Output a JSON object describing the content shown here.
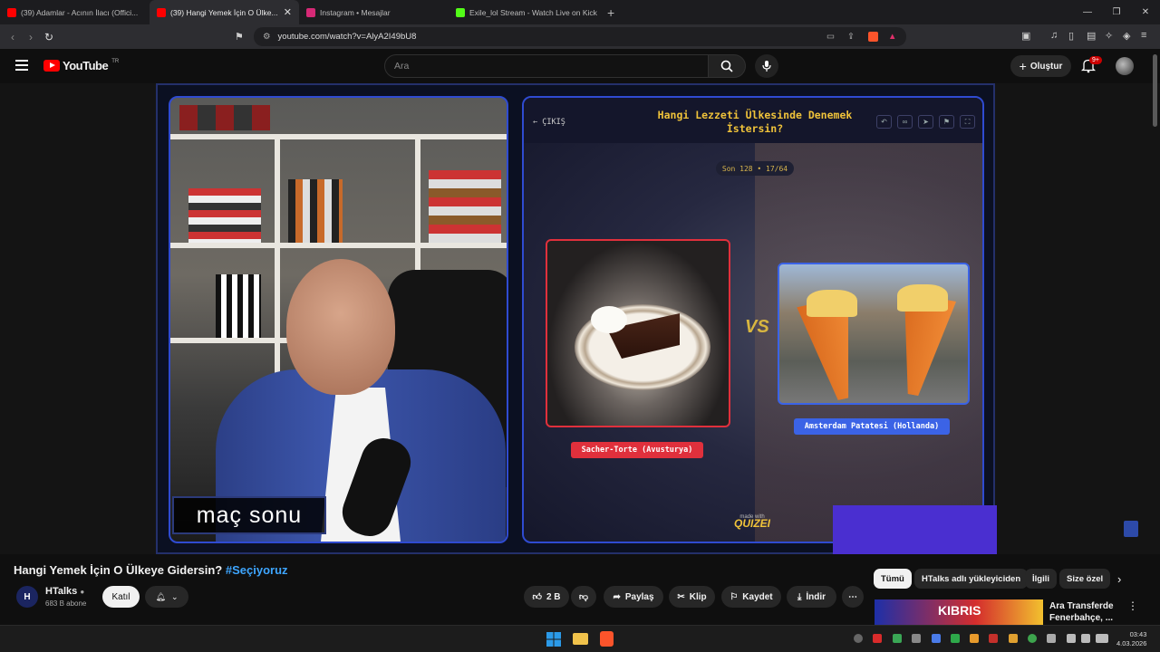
{
  "browser": {
    "tabs": [
      {
        "label": "(39) Adamlar - Acının İlacı (Offici...",
        "color": "#ff0000",
        "active": false
      },
      {
        "label": "(39) Hangi Yemek İçin O Ülke...",
        "color": "#ff0000",
        "active": true
      },
      {
        "label": "Instagram • Mesajlar",
        "color": "#d62976",
        "active": false
      },
      {
        "label": "Exile_lol Stream - Watch Live on Kick",
        "color": "#53fc18",
        "active": false
      }
    ],
    "url": "youtube.com/watch?v=AlyA2I49bU8"
  },
  "youtube": {
    "logo_text": "YouTube",
    "region": "TR",
    "search_placeholder": "Ara",
    "create_label": "Oluştur",
    "notif_count": "9+"
  },
  "video": {
    "cam_caption": "maç sonu",
    "quiz": {
      "back_label": "← ÇIKIŞ",
      "title": "Hangi Lezzeti Ülkesinde Denemek İstersin?",
      "round": "Son 128 • 17/64",
      "option_a": "Sacher-Torte (Avusturya)",
      "option_b": "Amsterdam Patatesi (Hollanda)",
      "vs": "VS",
      "made_with": "made with",
      "brand": "QUIZEI"
    }
  },
  "meta": {
    "title": "Hangi Yemek İçin O Ülkeye Gidersin?",
    "hashtag": "#Seçiyoruz",
    "channel": "HTalks",
    "subscribers": "683 B abone",
    "join_label": "Katıl",
    "likes": "2 B",
    "share_label": "Paylaş",
    "clip_label": "Klip",
    "save_label": "Kaydet",
    "download_label": "İndir"
  },
  "chips": [
    "Tümü",
    "HTalks adlı yükleyiciden",
    "İlgili",
    "Size özel"
  ],
  "recommendation": {
    "thumb_text": "KIBRIS",
    "title_line1": "Ara Transferde",
    "title_line2": "Fenerbahçe, ..."
  },
  "system": {
    "time": "03:43",
    "date": "4.03.2026"
  }
}
